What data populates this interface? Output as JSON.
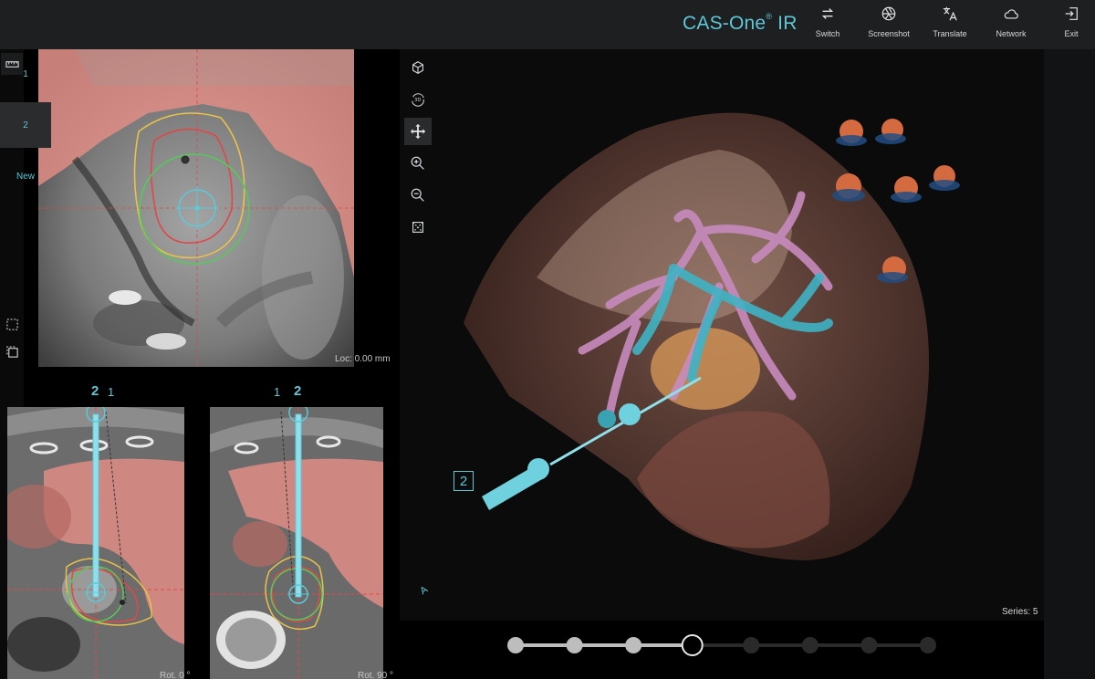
{
  "app": {
    "title": "CAS-One",
    "title_suffix": "IR",
    "reg_mark": "®"
  },
  "toolbar": [
    {
      "label": "Switch",
      "icon": "swap-icon"
    },
    {
      "label": "Screenshot",
      "icon": "aperture-icon"
    },
    {
      "label": "Translate",
      "icon": "translate-icon"
    },
    {
      "label": "Network",
      "icon": "cloud-icon"
    },
    {
      "label": "Exit",
      "icon": "exit-icon"
    }
  ],
  "views": {
    "top": {
      "loc_label": "Loc: 0.00 mm"
    },
    "bottom_left": {
      "rot_label": "Rot. 0 °",
      "needle_primary": "2",
      "needle_secondary": "1"
    },
    "bottom_right": {
      "rot_label": "Rot. 90 °",
      "needle_primary": "2",
      "needle_secondary": "1"
    }
  },
  "viewer3d": {
    "tools": [
      "cube-icon",
      "3d-rotate-icon",
      "pan-icon",
      "zoom-in-icon",
      "zoom-out-icon",
      "reset-view-icon"
    ],
    "needle_label": "2",
    "orientation_label": "A",
    "series_label": "Series: 5"
  },
  "series_panel": {
    "items": [
      "1",
      "2",
      "New"
    ],
    "selected": "2"
  },
  "slider": {
    "total_steps": 11,
    "current_index": 5
  },
  "colors": {
    "accent": "#5fc7d6",
    "tumor_outline_red": "#e04848",
    "margin_yellow": "#e8c24a",
    "ablation_green": "#55c95a",
    "liver_overlay": "#e0837a"
  }
}
